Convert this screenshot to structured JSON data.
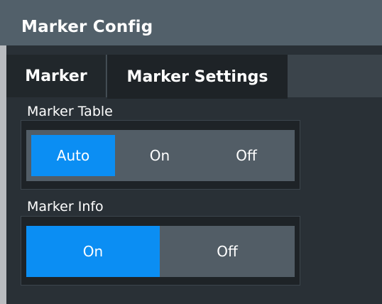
{
  "window": {
    "title": "Marker Config"
  },
  "tabs": [
    {
      "label": "Marker"
    },
    {
      "label": "Marker Settings"
    }
  ],
  "marker_table": {
    "label": "Marker Table",
    "options": [
      "Auto",
      "On",
      "Off"
    ],
    "selected": "Auto"
  },
  "marker_info": {
    "label": "Marker Info",
    "options": [
      "On",
      "Off"
    ],
    "selected": "On"
  },
  "colors": {
    "accent": "#0b8ef3",
    "panel": "#293036",
    "titlebar": "#52606a"
  }
}
